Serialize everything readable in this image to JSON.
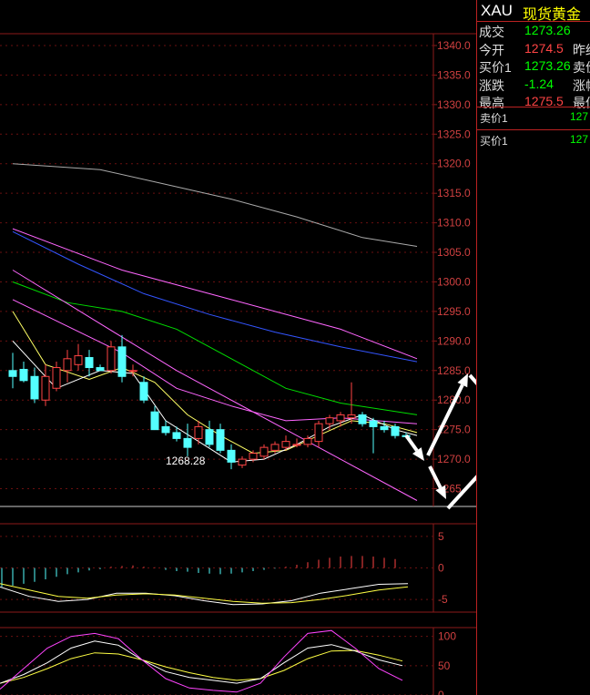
{
  "quote": {
    "symbol": "XAU",
    "name": "现货黄金",
    "rows": [
      {
        "label": "成交",
        "value": "1273.26",
        "color": "#00ff00",
        "label2": ""
      },
      {
        "label": "今开",
        "value": "1274.5",
        "color": "#ff4444",
        "label2": "昨结"
      },
      {
        "label": "买价1",
        "value": "1273.26",
        "color": "#00ff00",
        "label2": "卖价"
      },
      {
        "label": "涨跌",
        "value": "-1.24",
        "color": "#00ff00",
        "label2": "涨幅"
      },
      {
        "label": "最高",
        "value": "1275.5",
        "color": "#ff4444",
        "label2": "最低"
      }
    ],
    "ask": {
      "label": "卖价1",
      "value": "127"
    },
    "bid": {
      "label": "买价1",
      "value": "127"
    }
  },
  "chart_data": [
    {
      "type": "candlestick",
      "yaxis_ticks": [
        "1340.0",
        "1335.0",
        "1330.0",
        "1325.0",
        "1320.0",
        "1315.0",
        "1310.0",
        "1305.0",
        "1300.0",
        "1295.0",
        "1290.0",
        "1285.0",
        "1280.0",
        "1275.0",
        "1270.0",
        "1265"
      ],
      "ylim": [
        1262,
        1342
      ],
      "annotation": "1268.28",
      "colors": {
        "up": "#ff4444",
        "down": "#54ffff"
      },
      "candles": [
        {
          "o": 1285.0,
          "h": 1288.0,
          "l": 1282.0,
          "c": 1284.0
        },
        {
          "o": 1285.2,
          "h": 1286.5,
          "l": 1283.0,
          "c": 1283.3
        },
        {
          "o": 1284.0,
          "h": 1285.5,
          "l": 1279.5,
          "c": 1280.2
        },
        {
          "o": 1280.0,
          "h": 1286.0,
          "l": 1279.0,
          "c": 1284.0
        },
        {
          "o": 1282.0,
          "h": 1286.5,
          "l": 1281.5,
          "c": 1285.5
        },
        {
          "o": 1285.0,
          "h": 1288.5,
          "l": 1283.0,
          "c": 1287.0
        },
        {
          "o": 1286.0,
          "h": 1289.5,
          "l": 1285.0,
          "c": 1287.5
        },
        {
          "o": 1287.2,
          "h": 1288.5,
          "l": 1284.0,
          "c": 1285.5
        },
        {
          "o": 1285.5,
          "h": 1286.0,
          "l": 1285.0,
          "c": 1285.0
        },
        {
          "o": 1285.0,
          "h": 1290.0,
          "l": 1284.5,
          "c": 1289.0
        },
        {
          "o": 1289.0,
          "h": 1291.0,
          "l": 1283.0,
          "c": 1284.0
        },
        {
          "o": 1285.0,
          "h": 1286.0,
          "l": 1284.0,
          "c": 1285.0
        },
        {
          "o": 1283.0,
          "h": 1284.0,
          "l": 1279.5,
          "c": 1280.0
        },
        {
          "o": 1278.0,
          "h": 1279.0,
          "l": 1275.0,
          "c": 1275.0
        },
        {
          "o": 1275.5,
          "h": 1276.5,
          "l": 1274.0,
          "c": 1274.5
        },
        {
          "o": 1274.5,
          "h": 1275.5,
          "l": 1273.0,
          "c": 1273.5
        },
        {
          "o": 1273.5,
          "h": 1276.0,
          "l": 1270.5,
          "c": 1272.0
        },
        {
          "o": 1273.5,
          "h": 1276.5,
          "l": 1272.5,
          "c": 1275.5
        },
        {
          "o": 1275.0,
          "h": 1276.5,
          "l": 1272.0,
          "c": 1272.5
        },
        {
          "o": 1275.0,
          "h": 1276.0,
          "l": 1271.0,
          "c": 1271.5
        },
        {
          "o": 1271.5,
          "h": 1272.5,
          "l": 1268.3,
          "c": 1269.5
        },
        {
          "o": 1269.0,
          "h": 1270.5,
          "l": 1268.5,
          "c": 1270.0
        },
        {
          "o": 1270.0,
          "h": 1271.5,
          "l": 1269.5,
          "c": 1271.0
        },
        {
          "o": 1270.5,
          "h": 1272.5,
          "l": 1270.0,
          "c": 1272.0
        },
        {
          "o": 1271.5,
          "h": 1273.0,
          "l": 1271.0,
          "c": 1272.5
        },
        {
          "o": 1272.0,
          "h": 1274.0,
          "l": 1271.5,
          "c": 1273.0
        },
        {
          "o": 1272.5,
          "h": 1273.5,
          "l": 1272.0,
          "c": 1272.5
        },
        {
          "o": 1272.5,
          "h": 1274.0,
          "l": 1272.0,
          "c": 1273.5
        },
        {
          "o": 1273.0,
          "h": 1276.5,
          "l": 1272.0,
          "c": 1276.0
        },
        {
          "o": 1276.0,
          "h": 1277.5,
          "l": 1275.0,
          "c": 1277.0
        },
        {
          "o": 1276.5,
          "h": 1278.0,
          "l": 1275.5,
          "c": 1277.5
        },
        {
          "o": 1277.0,
          "h": 1283.0,
          "l": 1276.0,
          "c": 1277.5
        },
        {
          "o": 1277.5,
          "h": 1278.0,
          "l": 1275.5,
          "c": 1276.0
        },
        {
          "o": 1276.5,
          "h": 1277.0,
          "l": 1271.0,
          "c": 1275.5
        },
        {
          "o": 1275.5,
          "h": 1276.5,
          "l": 1274.5,
          "c": 1275.0
        },
        {
          "o": 1275.5,
          "h": 1276.0,
          "l": 1273.5,
          "c": 1274.0
        },
        {
          "o": 1274.0,
          "h": 1274.5,
          "l": 1273.5,
          "c": 1273.8
        }
      ],
      "ma_lines": [
        {
          "color": "#aaaaaa",
          "values": [
            [
              0,
              1320.0
            ],
            [
              8,
              1319.0
            ],
            [
              14,
              1316.5
            ],
            [
              20,
              1314.0
            ],
            [
              26,
              1311.0
            ],
            [
              32,
              1307.5
            ],
            [
              37,
              1306.0
            ]
          ]
        },
        {
          "color": "#3355ff",
          "values": [
            [
              0,
              1308.5
            ],
            [
              6,
              1303.0
            ],
            [
              12,
              1298.0
            ],
            [
              18,
              1294.5
            ],
            [
              24,
              1291.5
            ],
            [
              30,
              1289.0
            ],
            [
              37,
              1286.5
            ]
          ]
        },
        {
          "color": "#ff66ff",
          "values": [
            [
              0,
              1309.0
            ],
            [
              10,
              1302.0
            ],
            [
              20,
              1297.0
            ],
            [
              30,
              1292.0
            ],
            [
              37,
              1287.0
            ]
          ]
        },
        {
          "color": "#00dd00",
          "values": [
            [
              0,
              1300.0
            ],
            [
              5,
              1296.5
            ],
            [
              10,
              1295.0
            ],
            [
              15,
              1292.0
            ],
            [
              20,
              1287.0
            ],
            [
              25,
              1282.0
            ],
            [
              30,
              1279.5
            ],
            [
              37,
              1277.5
            ]
          ]
        },
        {
          "color": "#ff66ff",
          "values": [
            [
              0,
              1297.0
            ],
            [
              10,
              1288.0
            ],
            [
              15,
              1282.0
            ],
            [
              20,
              1279.0
            ],
            [
              25,
              1276.5
            ],
            [
              30,
              1277.0
            ],
            [
              37,
              1276.0
            ]
          ]
        },
        {
          "color": "#ffff66",
          "values": [
            [
              0,
              1295.0
            ],
            [
              3,
              1286.0
            ],
            [
              7,
              1283.5
            ],
            [
              10,
              1285.5
            ],
            [
              13,
              1283.0
            ],
            [
              16,
              1277.5
            ],
            [
              19,
              1274.0
            ],
            [
              22,
              1271.0
            ],
            [
              25,
              1271.5
            ],
            [
              28,
              1274.0
            ],
            [
              31,
              1276.5
            ],
            [
              34,
              1276.0
            ],
            [
              37,
              1274.5
            ]
          ]
        },
        {
          "color": "#ffffff",
          "values": [
            [
              0,
              1290.0
            ],
            [
              4,
              1282.0
            ],
            [
              8,
              1285.0
            ],
            [
              11,
              1284.5
            ],
            [
              14,
              1276.5
            ],
            [
              17,
              1273.0
            ],
            [
              20,
              1269.5
            ],
            [
              23,
              1270.0
            ],
            [
              26,
              1272.5
            ],
            [
              29,
              1275.5
            ],
            [
              32,
              1277.5
            ],
            [
              35,
              1275.0
            ],
            [
              37,
              1274.0
            ]
          ]
        },
        {
          "color": "#ff66ff",
          "values": [
            [
              0,
              1302.0
            ],
            [
              15,
              1285.0
            ],
            [
              25,
              1275.0
            ],
            [
              37,
              1263.0
            ]
          ]
        }
      ]
    },
    {
      "type": "macd",
      "yaxis_ticks": [
        "5",
        "0",
        "-5"
      ],
      "ylim": [
        -7,
        7
      ],
      "histogram": [
        -3.0,
        -2.8,
        -2.5,
        -2.2,
        -1.8,
        -1.4,
        -1.0,
        -0.7,
        -0.4,
        -0.2,
        0.2,
        0.3,
        0.4,
        0.2,
        0.1,
        -0.3,
        -0.5,
        -0.6,
        -0.8,
        -0.9,
        -1.0,
        -0.9,
        -0.7,
        -0.5,
        -0.3,
        -0.1,
        0.2,
        0.5,
        0.9,
        1.3,
        1.6,
        1.8,
        1.9,
        1.9,
        1.8,
        1.6,
        1.4
      ],
      "line_white": [
        -3.0,
        -4.5,
        -5.3,
        -5.0,
        -4.0,
        -4.0,
        -4.4,
        -5.2,
        -5.8,
        -5.7,
        -5.2,
        -4.0,
        -3.3,
        -2.6,
        -2.5
      ],
      "line_yellow": [
        -2.5,
        -3.5,
        -4.5,
        -4.8,
        -4.3,
        -4.1,
        -4.3,
        -4.8,
        -5.3,
        -5.6,
        -5.5,
        -5.0,
        -4.3,
        -3.5,
        -3.0
      ]
    },
    {
      "type": "kdj",
      "yaxis_ticks": [
        "100",
        "50",
        "0"
      ],
      "ylim": [
        0,
        115
      ],
      "k": [
        20,
        35,
        55,
        80,
        92,
        85,
        60,
        40,
        30,
        25,
        20,
        28,
        55,
        80,
        86,
        75,
        60,
        50
      ],
      "d": [
        20,
        30,
        45,
        62,
        72,
        70,
        60,
        48,
        38,
        30,
        25,
        28,
        42,
        62,
        75,
        76,
        68,
        58
      ],
      "j": [
        10,
        45,
        80,
        100,
        105,
        96,
        60,
        28,
        12,
        8,
        5,
        20,
        65,
        105,
        110,
        80,
        45,
        25
      ]
    }
  ]
}
